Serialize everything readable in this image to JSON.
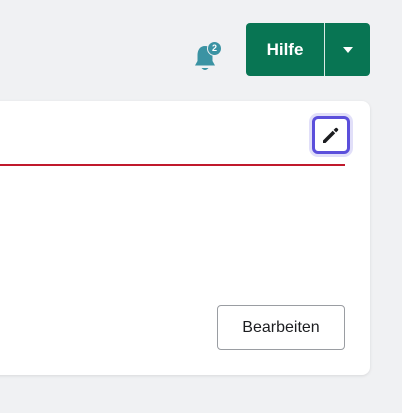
{
  "notifications": {
    "count": "2",
    "icon": "bell-icon",
    "color": "#3b93a3"
  },
  "help_button": {
    "label": "Hilfe",
    "dropdown_icon": "caret-down-icon",
    "color": "#087553"
  },
  "card": {
    "edit_icon": "pencil-icon",
    "edit_button_label": "Bearbeiten",
    "accent_line_color": "#c0192c",
    "focus_color": "#5b4fdb"
  }
}
